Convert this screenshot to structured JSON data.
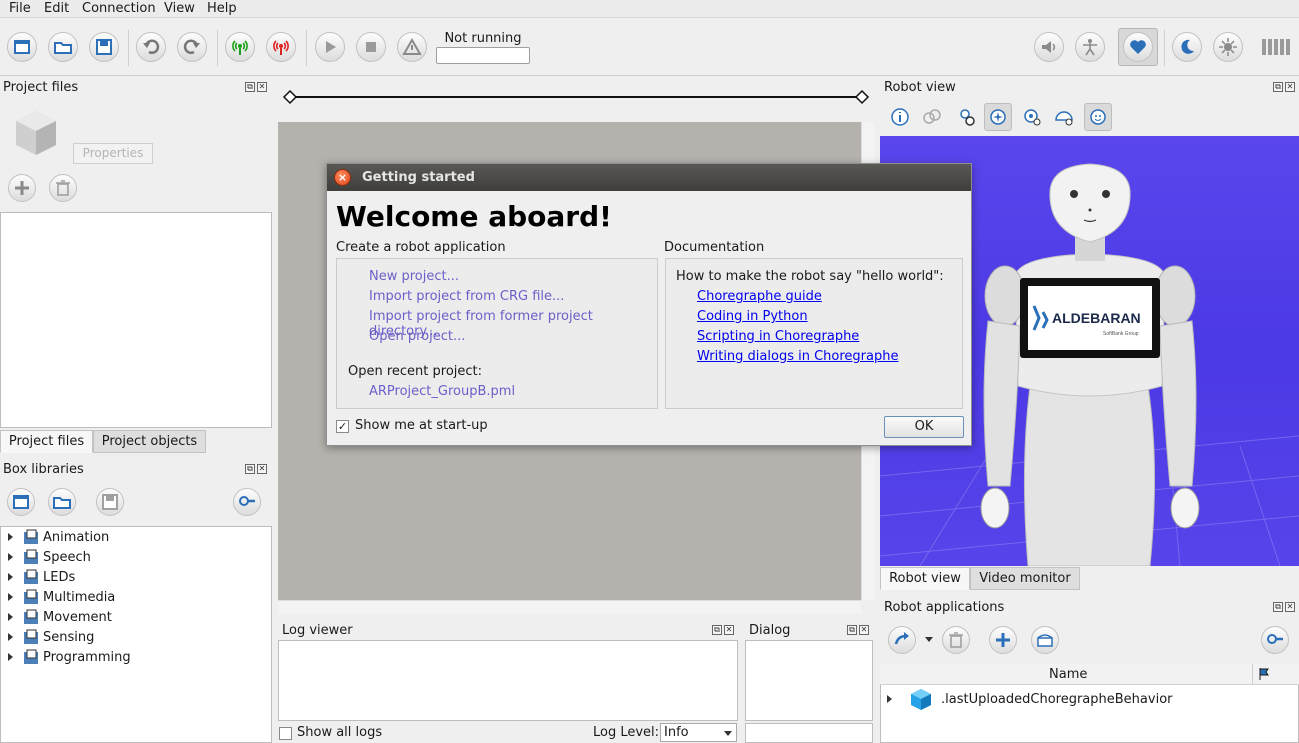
{
  "menu": [
    "File",
    "Edit",
    "Connection",
    "View",
    "Help"
  ],
  "toolbar": {
    "status_label": "Not running"
  },
  "project_files": {
    "title": "Project files",
    "properties_label": "Properties",
    "tabs": [
      "Project files",
      "Project objects"
    ]
  },
  "box_libraries": {
    "title": "Box libraries",
    "items": [
      "Animation",
      "Speech",
      "LEDs",
      "Multimedia",
      "Movement",
      "Sensing",
      "Programming"
    ]
  },
  "log_viewer": {
    "title": "Log viewer",
    "show_all_label": "Show all logs",
    "log_level_label": "Log Level:",
    "log_level_value": "Info"
  },
  "dialog_panel": {
    "title": "Dialog"
  },
  "robot_view": {
    "title": "Robot view",
    "tabs": [
      "Robot view",
      "Video monitor"
    ],
    "tablet_brand": "ALDEBARAN",
    "tablet_sub": "SoftBank Group"
  },
  "robot_apps": {
    "title": "Robot applications",
    "column_name": "Name",
    "items": [
      ".lastUploadedChoregrapheBehavior"
    ]
  },
  "modal": {
    "title": "Getting started",
    "heading": "Welcome aboard!",
    "create_title": "Create a robot application",
    "create_links": [
      "New project...",
      "Import project from CRG file...",
      "Import project from former project directory...",
      "Open project..."
    ],
    "recent_title": "Open recent project:",
    "recent_items": [
      "ARProject_GroupB.pml"
    ],
    "doc_title": "Documentation",
    "doc_intro": "How to make the robot say \"hello world\":",
    "doc_links": [
      "Choregraphe guide",
      "Coding in Python",
      "Scripting in Choregraphe",
      "Writing dialogs in Choregraphe"
    ],
    "show_startup_label": "Show me at start-up",
    "show_startup_checked": true,
    "ok_label": "OK"
  },
  "colors": {
    "robot_view_bg": "#4b39e4",
    "canvas_bg": "#b5b1ad",
    "link": "#0000ee",
    "action_link": "#6a5fc8"
  }
}
